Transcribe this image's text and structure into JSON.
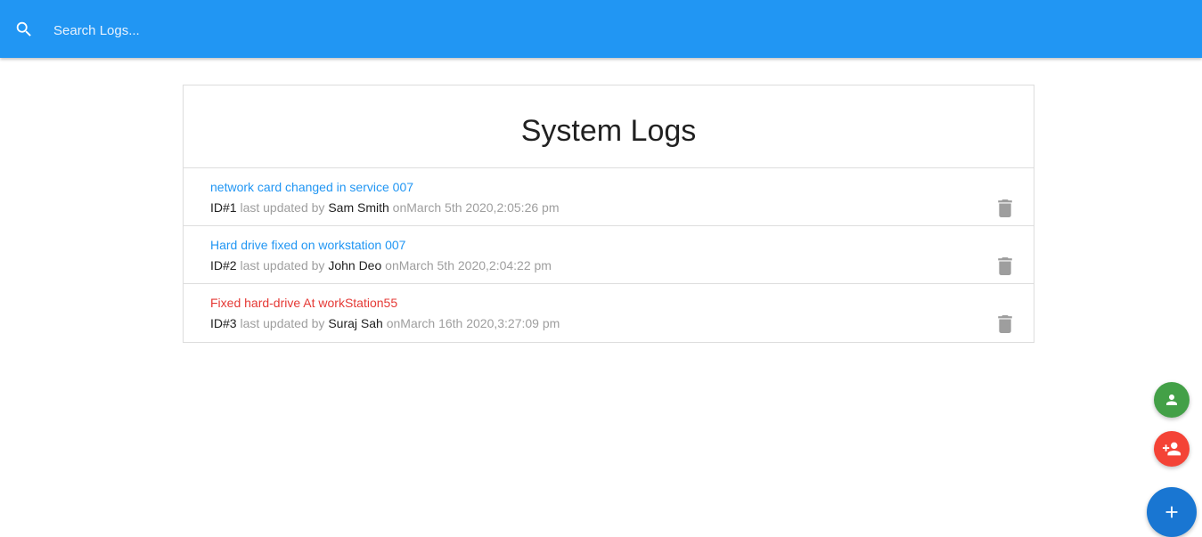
{
  "search": {
    "placeholder": "Search Logs..."
  },
  "main": {
    "title": "System Logs"
  },
  "logs": [
    {
      "message": "network card changed in service 007",
      "id_label": "ID#1",
      "updated_by_text": " last updated by ",
      "tech": "Sam Smith",
      "on_text": " on",
      "date": "March 5th 2020,2:05:26 pm",
      "attention": false
    },
    {
      "message": "Hard drive fixed on workstation 007",
      "id_label": "ID#2",
      "updated_by_text": " last updated by ",
      "tech": "John Deo",
      "on_text": " on",
      "date": "March 5th 2020,2:04:22 pm",
      "attention": false
    },
    {
      "message": "Fixed hard-drive At workStation55",
      "id_label": "ID#3",
      "updated_by_text": " last updated by ",
      "tech": "Suraj Sah",
      "on_text": " on",
      "date": "March 16th 2020,3:27:09 pm",
      "attention": true
    }
  ],
  "colors": {
    "navbar": "#2196f3",
    "link_normal": "#2196f3",
    "link_attention": "#e53935",
    "fab_green": "#43a047",
    "fab_red": "#f44336",
    "fab_blue": "#1976d2"
  },
  "icons": {
    "search": "search-icon",
    "delete": "delete-icon",
    "person": "person-icon",
    "person_add": "person-add-icon",
    "add": "add-icon"
  }
}
